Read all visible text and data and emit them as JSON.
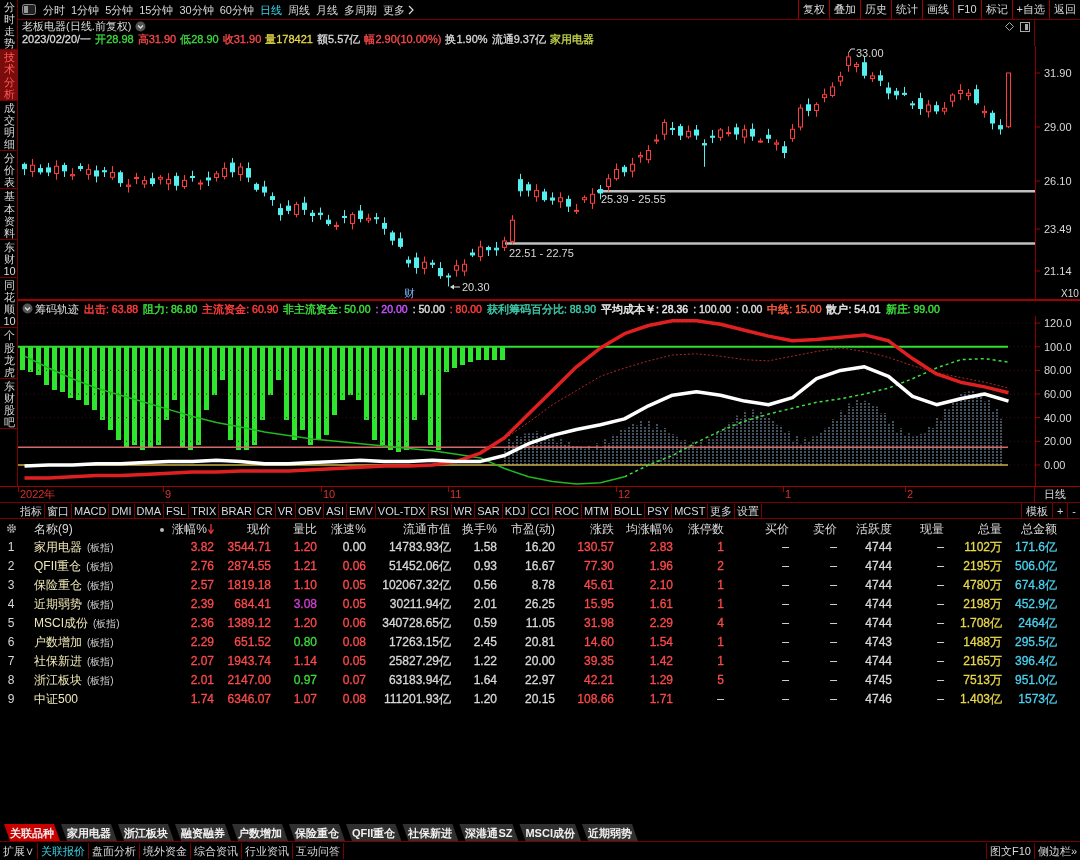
{
  "side_tabs": [
    {
      "label": "分时走势",
      "selected": false
    },
    {
      "label": "技术分析",
      "selected": true
    },
    {
      "label": "成交明细",
      "selected": false
    },
    {
      "label": "分价表",
      "selected": false
    },
    {
      "label": "基本资料",
      "selected": false
    },
    {
      "label": "东财10",
      "selected": false
    },
    {
      "label": "同花顺10",
      "selected": false
    },
    {
      "label": "个股龙虎",
      "selected": false
    },
    {
      "label": "东财股吧",
      "selected": false
    }
  ],
  "toolbar": {
    "periods": [
      {
        "label": "分时",
        "selected": false
      },
      {
        "label": "1分钟",
        "selected": false
      },
      {
        "label": "5分钟",
        "selected": false
      },
      {
        "label": "15分钟",
        "selected": false
      },
      {
        "label": "30分钟",
        "selected": false
      },
      {
        "label": "60分钟",
        "selected": false
      },
      {
        "label": "日线",
        "selected": true
      },
      {
        "label": "周线",
        "selected": false
      },
      {
        "label": "月线",
        "selected": false
      },
      {
        "label": "多周期",
        "selected": false
      }
    ],
    "more": "更多",
    "buttons": [
      "复权",
      "叠加",
      "历史",
      "统计",
      "画线",
      "F10",
      "标记",
      "+自选",
      "返回"
    ]
  },
  "quote": {
    "title": "老板电器(日线.前复权)",
    "fields": [
      {
        "text": "2023/02/20/一",
        "color": "#d8d8d8"
      },
      {
        "text": "开28.98",
        "color": "#3cdc3c"
      },
      {
        "text": "高31.90",
        "color": "#ff4a4a"
      },
      {
        "text": "低28.90",
        "color": "#3cdc3c"
      },
      {
        "text": "收31.90",
        "color": "#ff4a4a"
      },
      {
        "text": "量178421",
        "color": "#e8d84a"
      },
      {
        "text": "额5.57亿",
        "color": "#d8d8d8"
      },
      {
        "text": "幅2.90(10.00%)",
        "color": "#ff4a4a"
      },
      {
        "text": "换1.90%",
        "color": "#d8d8d8"
      },
      {
        "text": "流通9.37亿",
        "color": "#d8d8d8"
      },
      {
        "text": "家用电器",
        "color": "#c8d84a"
      }
    ]
  },
  "main_chart": {
    "price_labels": [
      "31.90",
      "29.00",
      "26.10",
      "23.49",
      "21.14"
    ],
    "annotations": [
      "33.00",
      "25.39 - 25.55",
      "22.51 - 22.75",
      "20.30"
    ],
    "event_marker": "财",
    "scale": "X10"
  },
  "indicator": {
    "title": "筹码轨迹",
    "values": [
      {
        "text": "出击: 63.88",
        "color": "#ff3c3c"
      },
      {
        "text": "阻力: 86.80",
        "color": "#3cdc3c"
      },
      {
        "text": "主流资金: 60.90",
        "color": "#ff3c3c"
      },
      {
        "text": "非主流资金: 50.00",
        "color": "#3cdc3c"
      },
      {
        "text": ": 20.00",
        "color": "#c850ff"
      },
      {
        "text": ": 50.00",
        "color": "#d8d8d8"
      },
      {
        "text": ": 80.00",
        "color": "#ff3c3c"
      },
      {
        "text": "获利筹码百分比: 88.90",
        "color": "#3cc8a8"
      },
      {
        "text": "平均成本￥: 28.36",
        "color": "#e8e8e8"
      },
      {
        "text": ": 100.00",
        "color": "#d8d8d8"
      },
      {
        "text": ": 0.00",
        "color": "#d8d8d8"
      },
      {
        "text": "中线: 15.00",
        "color": "#ff5a3c"
      },
      {
        "text": "散户: 54.01",
        "color": "#e8e8e8"
      },
      {
        "text": "新庄: 99.00",
        "color": "#3cdc3c"
      }
    ],
    "chart_data": {
      "type": "line",
      "categories": [
        null,
        null,
        null,
        null,
        null,
        null,
        null,
        null,
        null,
        null,
        null,
        null,
        null,
        null,
        null,
        null,
        null,
        null,
        null,
        null,
        null,
        null,
        null,
        null,
        null,
        null,
        null,
        null,
        null,
        null,
        null,
        null,
        null,
        null,
        null,
        null,
        null,
        null,
        null,
        null,
        null,
        null
      ],
      "ylim": [
        -17.8,
        126
      ],
      "yticks": [
        {
          "value": 120,
          "label": "120.0"
        },
        {
          "value": 100,
          "label": "100.0"
        },
        {
          "value": 80,
          "label": "80.00"
        },
        {
          "value": 60,
          "label": "60.00"
        },
        {
          "value": 40,
          "label": "40.00"
        },
        {
          "value": 20,
          "label": "20.00"
        },
        {
          "value": 0,
          "label": "0.00"
        }
      ],
      "grid": true,
      "ref_lines": [
        {
          "axis": "y",
          "value": 100,
          "color": "#30e030"
        },
        {
          "axis": "y",
          "value": 15,
          "color": "#d86868"
        },
        {
          "axis": "y",
          "value": 0,
          "color": "#c8b040"
        }
      ],
      "series": [
        {
          "color": "#b02828",
          "line_style": "dotted",
          "values": [
            null,
            null,
            null,
            null,
            null,
            null,
            null,
            null,
            null,
            null,
            null,
            null,
            null,
            null,
            null,
            null,
            null,
            null,
            null,
            12,
            22,
            36,
            51,
            63,
            75,
            82,
            88,
            93,
            94,
            92,
            89,
            88,
            92,
            96,
            99,
            96,
            91,
            84,
            78,
            74,
            70,
            65
          ]
        },
        {
          "color": "#22b822",
          "values": [
            92,
            82,
            73,
            65,
            59,
            53,
            47,
            41,
            36,
            32,
            28,
            25,
            22,
            20,
            18,
            16,
            14,
            12,
            9,
            6,
            -3,
            -10,
            -14,
            -16,
            -15,
            -10,
            null,
            null,
            null,
            null,
            null,
            null,
            null,
            null,
            null,
            null,
            null,
            null,
            null,
            null,
            null,
            null
          ]
        },
        {
          "color": "#3ce03c",
          "line_style": "dashed",
          "values": [
            null,
            null,
            null,
            null,
            null,
            null,
            null,
            null,
            null,
            null,
            null,
            null,
            null,
            null,
            null,
            null,
            null,
            null,
            null,
            null,
            null,
            null,
            null,
            null,
            null,
            -10,
            0,
            8,
            19,
            29,
            37,
            43,
            48,
            53,
            56,
            60,
            65,
            73,
            82,
            89,
            90,
            87
          ]
        },
        {
          "color": "#e02020",
          "values": [
            -11,
            -11,
            -10,
            -9,
            -9,
            -8,
            -7,
            -6,
            -6,
            -5,
            -5,
            -5,
            -4,
            -3,
            -2,
            -1,
            -1,
            0,
            3,
            10,
            23,
            43,
            63,
            83,
            99,
            111,
            118,
            122,
            122,
            119,
            114,
            109,
            105,
            106,
            108,
            110,
            105,
            90,
            77,
            70,
            66,
            61
          ]
        },
        {
          "color": "#ffffff",
          "values": [
            -1,
            0,
            0,
            1,
            1,
            2,
            3,
            3,
            4,
            3,
            1,
            1,
            2,
            3,
            4,
            3,
            3,
            4,
            3,
            3,
            8,
            18,
            25,
            30,
            34,
            39,
            50,
            59,
            62,
            59,
            54,
            51,
            57,
            73,
            80,
            83,
            75,
            58,
            51,
            56,
            60,
            54
          ]
        }
      ]
    }
  },
  "time_axis": {
    "labels": [
      "2022年",
      "9",
      "10",
      "11",
      "12",
      "1",
      "2"
    ],
    "period": "日线"
  },
  "indicator_tabs": {
    "items": [
      "指标",
      "窗口",
      "MACD",
      "DMI",
      "DMA",
      "FSL",
      "TRIX",
      "BRAR",
      "CR",
      "VR",
      "OBV",
      "ASI",
      "EMV",
      "VOL-TDX",
      "RSI",
      "WR",
      "SAR",
      "KDJ",
      "CCI",
      "ROC",
      "MTM",
      "BOLL",
      "PSY",
      "MCST",
      "更多",
      "设置"
    ],
    "right": [
      "模板",
      "+",
      "-"
    ]
  },
  "table": {
    "columns": [
      {
        "label": "名称(9)",
        "sorted": false
      },
      {
        "label": "涨幅%",
        "sorted": true
      },
      {
        "label": "现价",
        "sorted": false
      },
      {
        "label": "量比",
        "sorted": false
      },
      {
        "label": "涨速%",
        "sorted": false
      },
      {
        "label": "流通市值",
        "sorted": false
      },
      {
        "label": "换手%",
        "sorted": false
      },
      {
        "label": "市盈(动)",
        "sorted": false
      },
      {
        "label": "涨跌",
        "sorted": false
      },
      {
        "label": "均涨幅%",
        "sorted": false
      },
      {
        "label": "涨停数",
        "sorted": false
      },
      {
        "label": "买价",
        "sorted": false
      },
      {
        "label": "卖价",
        "sorted": false
      },
      {
        "label": "活跃度",
        "sorted": false
      },
      {
        "label": "现量",
        "sorted": false
      },
      {
        "label": "总量",
        "sorted": false
      },
      {
        "label": "总金额",
        "sorted": false
      }
    ],
    "rows": [
      {
        "number": "1",
        "cells": [
          {
            "text": "家用电器",
            "tag": "(板指)"
          },
          {
            "text": "3.82",
            "color": "#ff4a4a"
          },
          {
            "text": "3544.71",
            "color": "#ff4a4a"
          },
          {
            "text": "1.20",
            "color": "#ff4a4a"
          },
          {
            "text": "0.00",
            "color": "#d8d8d8"
          },
          {
            "text": "14783.93亿",
            "color": "#d8d8d8"
          },
          {
            "text": "1.58",
            "color": "#d8d8d8"
          },
          {
            "text": "16.20",
            "color": "#d8d8d8"
          },
          {
            "text": "130.57",
            "color": "#ff4a4a"
          },
          {
            "text": "2.83",
            "color": "#ff4a4a"
          },
          {
            "text": "1",
            "color": "#ff4a4a"
          },
          {
            "text": "–",
            "color": "#d8d8d8"
          },
          {
            "text": "–",
            "color": "#d8d8d8"
          },
          {
            "text": "4744",
            "color": "#d8d8d8"
          },
          {
            "text": "–",
            "color": "#d8d8d8"
          },
          {
            "text": "1102万",
            "color": "#e8d84a"
          },
          {
            "text": "171.6亿",
            "color": "#4ad2f0"
          }
        ]
      },
      {
        "number": "2",
        "cells": [
          {
            "text": "QFII重仓",
            "tag": "(板指)"
          },
          {
            "text": "2.76",
            "color": "#ff4a4a"
          },
          {
            "text": "2874.55",
            "color": "#ff4a4a"
          },
          {
            "text": "1.21",
            "color": "#ff4a4a"
          },
          {
            "text": "0.06",
            "color": "#ff4a4a"
          },
          {
            "text": "51452.06亿",
            "color": "#d8d8d8"
          },
          {
            "text": "0.93",
            "color": "#d8d8d8"
          },
          {
            "text": "16.67",
            "color": "#d8d8d8"
          },
          {
            "text": "77.30",
            "color": "#ff4a4a"
          },
          {
            "text": "1.96",
            "color": "#ff4a4a"
          },
          {
            "text": "2",
            "color": "#ff4a4a"
          },
          {
            "text": "–",
            "color": "#d8d8d8"
          },
          {
            "text": "–",
            "color": "#d8d8d8"
          },
          {
            "text": "4744",
            "color": "#d8d8d8"
          },
          {
            "text": "–",
            "color": "#d8d8d8"
          },
          {
            "text": "2195万",
            "color": "#e8d84a"
          },
          {
            "text": "506.0亿",
            "color": "#4ad2f0"
          }
        ]
      },
      {
        "number": "3",
        "cells": [
          {
            "text": "保险重仓",
            "tag": "(板指)"
          },
          {
            "text": "2.57",
            "color": "#ff4a4a"
          },
          {
            "text": "1819.18",
            "color": "#ff4a4a"
          },
          {
            "text": "1.10",
            "color": "#ff4a4a"
          },
          {
            "text": "0.05",
            "color": "#ff4a4a"
          },
          {
            "text": "102067.32亿",
            "color": "#d8d8d8"
          },
          {
            "text": "0.56",
            "color": "#d8d8d8"
          },
          {
            "text": "8.78",
            "color": "#d8d8d8"
          },
          {
            "text": "45.61",
            "color": "#ff4a4a"
          },
          {
            "text": "2.10",
            "color": "#ff4a4a"
          },
          {
            "text": "1",
            "color": "#ff4a4a"
          },
          {
            "text": "–",
            "color": "#d8d8d8"
          },
          {
            "text": "–",
            "color": "#d8d8d8"
          },
          {
            "text": "4744",
            "color": "#d8d8d8"
          },
          {
            "text": "–",
            "color": "#d8d8d8"
          },
          {
            "text": "4780万",
            "color": "#e8d84a"
          },
          {
            "text": "674.8亿",
            "color": "#4ad2f0"
          }
        ]
      },
      {
        "number": "4",
        "cells": [
          {
            "text": "近期弱势",
            "tag": "(板指)"
          },
          {
            "text": "2.39",
            "color": "#ff4a4a"
          },
          {
            "text": "684.41",
            "color": "#ff4a4a"
          },
          {
            "text": "3.08",
            "color": "#d040d0"
          },
          {
            "text": "0.05",
            "color": "#ff4a4a"
          },
          {
            "text": "30211.94亿",
            "color": "#d8d8d8"
          },
          {
            "text": "2.01",
            "color": "#d8d8d8"
          },
          {
            "text": "26.25",
            "color": "#d8d8d8"
          },
          {
            "text": "15.95",
            "color": "#ff4a4a"
          },
          {
            "text": "1.61",
            "color": "#ff4a4a"
          },
          {
            "text": "1",
            "color": "#ff4a4a"
          },
          {
            "text": "–",
            "color": "#d8d8d8"
          },
          {
            "text": "–",
            "color": "#d8d8d8"
          },
          {
            "text": "4744",
            "color": "#d8d8d8"
          },
          {
            "text": "–",
            "color": "#d8d8d8"
          },
          {
            "text": "2198万",
            "color": "#e8d84a"
          },
          {
            "text": "452.9亿",
            "color": "#4ad2f0"
          }
        ]
      },
      {
        "number": "5",
        "cells": [
          {
            "text": "MSCI成份",
            "tag": "(板指)"
          },
          {
            "text": "2.36",
            "color": "#ff4a4a"
          },
          {
            "text": "1389.12",
            "color": "#ff4a4a"
          },
          {
            "text": "1.20",
            "color": "#ff4a4a"
          },
          {
            "text": "0.06",
            "color": "#ff4a4a"
          },
          {
            "text": "340728.65亿",
            "color": "#d8d8d8"
          },
          {
            "text": "0.59",
            "color": "#d8d8d8"
          },
          {
            "text": "11.05",
            "color": "#d8d8d8"
          },
          {
            "text": "31.98",
            "color": "#ff4a4a"
          },
          {
            "text": "2.29",
            "color": "#ff4a4a"
          },
          {
            "text": "4",
            "color": "#ff4a4a"
          },
          {
            "text": "–",
            "color": "#d8d8d8"
          },
          {
            "text": "–",
            "color": "#d8d8d8"
          },
          {
            "text": "4744",
            "color": "#d8d8d8"
          },
          {
            "text": "–",
            "color": "#d8d8d8"
          },
          {
            "text": "1.708亿",
            "color": "#e8d84a"
          },
          {
            "text": "2464亿",
            "color": "#4ad2f0"
          }
        ]
      },
      {
        "number": "6",
        "cells": [
          {
            "text": "户数增加",
            "tag": "(板指)"
          },
          {
            "text": "2.29",
            "color": "#ff4a4a"
          },
          {
            "text": "651.52",
            "color": "#ff4a4a"
          },
          {
            "text": "0.80",
            "color": "#3cdc3c"
          },
          {
            "text": "0.08",
            "color": "#ff4a4a"
          },
          {
            "text": "17263.15亿",
            "color": "#d8d8d8"
          },
          {
            "text": "2.45",
            "color": "#d8d8d8"
          },
          {
            "text": "20.81",
            "color": "#d8d8d8"
          },
          {
            "text": "14.60",
            "color": "#ff4a4a"
          },
          {
            "text": "1.54",
            "color": "#ff4a4a"
          },
          {
            "text": "1",
            "color": "#ff4a4a"
          },
          {
            "text": "–",
            "color": "#d8d8d8"
          },
          {
            "text": "–",
            "color": "#d8d8d8"
          },
          {
            "text": "4743",
            "color": "#d8d8d8"
          },
          {
            "text": "–",
            "color": "#d8d8d8"
          },
          {
            "text": "1488万",
            "color": "#e8d84a"
          },
          {
            "text": "295.5亿",
            "color": "#4ad2f0"
          }
        ]
      },
      {
        "number": "7",
        "cells": [
          {
            "text": "社保新进",
            "tag": "(板指)"
          },
          {
            "text": "2.07",
            "color": "#ff4a4a"
          },
          {
            "text": "1943.74",
            "color": "#ff4a4a"
          },
          {
            "text": "1.14",
            "color": "#ff4a4a"
          },
          {
            "text": "0.05",
            "color": "#ff4a4a"
          },
          {
            "text": "25827.29亿",
            "color": "#d8d8d8"
          },
          {
            "text": "1.22",
            "color": "#d8d8d8"
          },
          {
            "text": "20.00",
            "color": "#d8d8d8"
          },
          {
            "text": "39.35",
            "color": "#ff4a4a"
          },
          {
            "text": "1.42",
            "color": "#ff4a4a"
          },
          {
            "text": "1",
            "color": "#ff4a4a"
          },
          {
            "text": "–",
            "color": "#d8d8d8"
          },
          {
            "text": "–",
            "color": "#d8d8d8"
          },
          {
            "text": "4744",
            "color": "#d8d8d8"
          },
          {
            "text": "–",
            "color": "#d8d8d8"
          },
          {
            "text": "2165万",
            "color": "#e8d84a"
          },
          {
            "text": "396.4亿",
            "color": "#4ad2f0"
          }
        ]
      },
      {
        "number": "8",
        "cells": [
          {
            "text": "浙江板块",
            "tag": "(板指)"
          },
          {
            "text": "2.01",
            "color": "#ff4a4a"
          },
          {
            "text": "2147.00",
            "color": "#ff4a4a"
          },
          {
            "text": "0.97",
            "color": "#3cdc3c"
          },
          {
            "text": "0.07",
            "color": "#ff4a4a"
          },
          {
            "text": "63183.94亿",
            "color": "#d8d8d8"
          },
          {
            "text": "1.64",
            "color": "#d8d8d8"
          },
          {
            "text": "22.97",
            "color": "#d8d8d8"
          },
          {
            "text": "42.21",
            "color": "#ff4a4a"
          },
          {
            "text": "1.29",
            "color": "#ff4a4a"
          },
          {
            "text": "5",
            "color": "#ff4a4a"
          },
          {
            "text": "–",
            "color": "#d8d8d8"
          },
          {
            "text": "–",
            "color": "#d8d8d8"
          },
          {
            "text": "4745",
            "color": "#d8d8d8"
          },
          {
            "text": "–",
            "color": "#d8d8d8"
          },
          {
            "text": "7513万",
            "color": "#e8d84a"
          },
          {
            "text": "951.0亿",
            "color": "#4ad2f0"
          }
        ]
      },
      {
        "number": "9",
        "cells": [
          {
            "text": "中证500"
          },
          {
            "text": "1.74",
            "color": "#ff4a4a"
          },
          {
            "text": "6346.07",
            "color": "#ff4a4a"
          },
          {
            "text": "1.07",
            "color": "#ff4a4a"
          },
          {
            "text": "0.08",
            "color": "#ff4a4a"
          },
          {
            "text": "111201.93亿",
            "color": "#d8d8d8"
          },
          {
            "text": "1.20",
            "color": "#d8d8d8"
          },
          {
            "text": "20.15",
            "color": "#d8d8d8"
          },
          {
            "text": "108.66",
            "color": "#ff4a4a"
          },
          {
            "text": "1.71",
            "color": "#ff4a4a"
          },
          {
            "text": "–",
            "color": "#d8d8d8"
          },
          {
            "text": "–",
            "color": "#d8d8d8"
          },
          {
            "text": "–",
            "color": "#d8d8d8"
          },
          {
            "text": "4746",
            "color": "#d8d8d8"
          },
          {
            "text": "–",
            "color": "#d8d8d8"
          },
          {
            "text": "1.403亿",
            "color": "#e8d84a"
          },
          {
            "text": "1573亿",
            "color": "#4ad2f0"
          }
        ]
      }
    ]
  },
  "related_tabs": [
    {
      "label": "关联品种",
      "selected": true
    },
    {
      "label": "家用电器",
      "selected": false
    },
    {
      "label": "浙江板块",
      "selected": false
    },
    {
      "label": "融资融券",
      "selected": false
    },
    {
      "label": "户数增加",
      "selected": false
    },
    {
      "label": "保险重仓",
      "selected": false
    },
    {
      "label": "QFII重仓",
      "selected": false
    },
    {
      "label": "社保新进",
      "selected": false
    },
    {
      "label": "深港通SZ",
      "selected": false
    },
    {
      "label": "MSCI成份",
      "selected": false
    },
    {
      "label": "近期弱势",
      "selected": false
    }
  ],
  "bottom_bar": {
    "items": [
      {
        "label": "扩展∨",
        "selected": false
      },
      {
        "label": "关联报价",
        "selected": true
      },
      {
        "label": "盘面分析",
        "selected": false
      },
      {
        "label": "境外资金",
        "selected": false
      },
      {
        "label": "综合资讯",
        "selected": false
      },
      {
        "label": "行业资讯",
        "selected": false
      },
      {
        "label": "互动问答",
        "selected": false
      }
    ],
    "right": [
      "图文F10",
      "侧边栏»"
    ]
  }
}
